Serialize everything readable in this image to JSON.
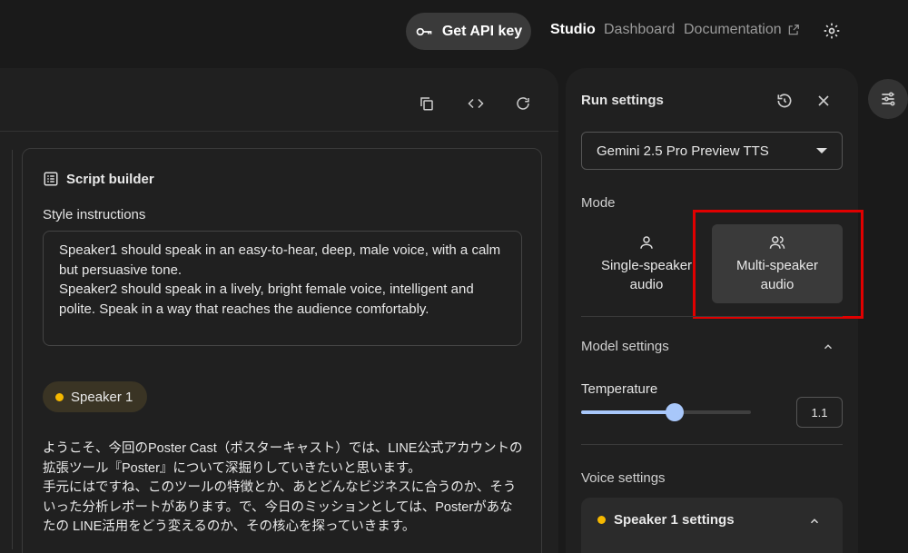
{
  "header": {
    "api_button": "Get API key",
    "nav_studio": "Studio",
    "nav_dashboard": "Dashboard",
    "nav_documentation": "Documentation"
  },
  "script_builder": {
    "title": "Script builder",
    "style_label": "Style instructions",
    "style_text": "Speaker1 should speak in an easy-to-hear, deep, male voice, with a calm but persuasive tone.\nSpeaker2 should speak in a lively, bright female voice, intelligent and polite. Speak in a way that reaches the audience comfortably.",
    "speaker_label": "Speaker 1",
    "speech_text": "ようこそ、今回のPoster Cast（ポスターキャスト）では、LINE公式アカウントの拡張ツール『Poster』について深掘りしていきたいと思います。\n手元にはですね、このツールの特徴とか、あとどんなビジネスに合うのか、そういった分析レポートがあります。で、今日のミッションとしては、Posterがあなたの LINE活用をどう変えるのか、その核心を探っていきます。"
  },
  "run_settings": {
    "title": "Run settings",
    "model": "Gemini 2.5 Pro Preview TTS",
    "mode_label": "Mode",
    "mode_single": "Single-speaker\naudio",
    "mode_multi": "Multi-speaker\naudio",
    "model_settings": "Model settings",
    "temperature_label": "Temperature",
    "temperature_value": "1.1",
    "temperature_fraction": 0.55,
    "voice_settings": "Voice settings",
    "speaker1_settings": "Speaker 1 settings"
  },
  "colors": {
    "accent": "#a8c7fa",
    "speaker_dot": "#f5b800",
    "highlight": "#e00000"
  }
}
